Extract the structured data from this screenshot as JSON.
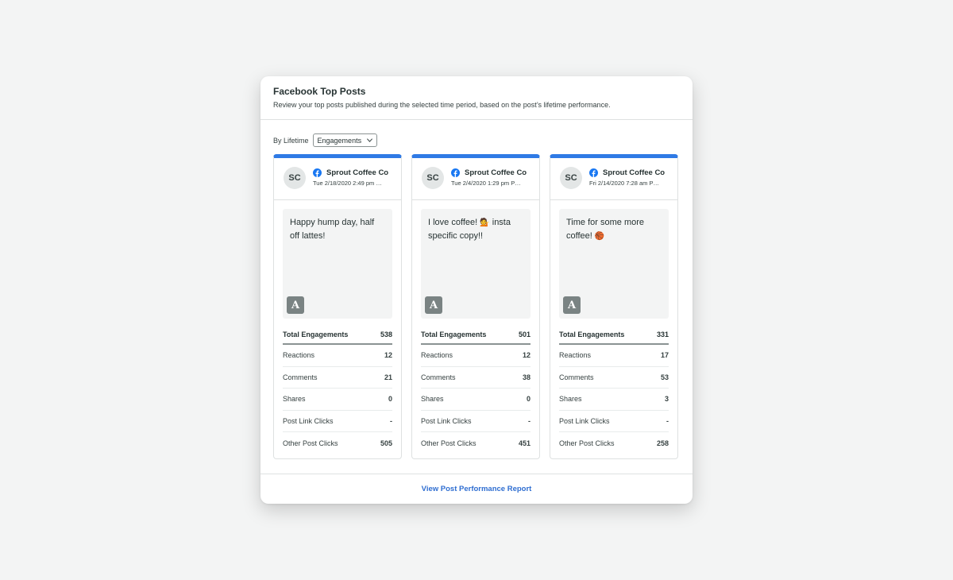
{
  "widget": {
    "title": "Facebook Top Posts",
    "subtitle": "Review your top posts published during the selected time period, based on the post’s lifetime performance."
  },
  "filter": {
    "label": "By Lifetime",
    "selected": "Engagements"
  },
  "colors": {
    "accent": "#2f7ae5",
    "facebook": "#1877f2",
    "link": "#2f6ed1"
  },
  "metric_labels": {
    "total": "Total Engagements",
    "reactions": "Reactions",
    "comments": "Comments",
    "shares": "Shares",
    "post_link_clicks": "Post Link Clicks",
    "other_post_clicks": "Other Post Clicks"
  },
  "posts": [
    {
      "avatar": "SC",
      "account": "Sprout Coffee Co",
      "timestamp": "Tue 2/18/2020 2:49 pm …",
      "text": "Happy hump day, half off lattes!",
      "emoji": "",
      "badge": "A",
      "metrics": {
        "total": "538",
        "reactions": "12",
        "comments": "21",
        "shares": "0",
        "post_link_clicks": "-",
        "other_post_clicks": "505"
      }
    },
    {
      "avatar": "SC",
      "account": "Sprout Coffee Co",
      "timestamp": "Tue 2/4/2020 1:29 pm P…",
      "text": "I love coffee!",
      "emoji": "💁",
      "text_after": " insta specific copy!!",
      "badge": "A",
      "metrics": {
        "total": "501",
        "reactions": "12",
        "comments": "38",
        "shares": "0",
        "post_link_clicks": "-",
        "other_post_clicks": "451"
      }
    },
    {
      "avatar": "SC",
      "account": "Sprout Coffee Co",
      "timestamp": "Fri 2/14/2020 7:28 am P…",
      "text": "Time for some more coffee!",
      "emoji": "🏀",
      "badge": "A",
      "metrics": {
        "total": "331",
        "reactions": "17",
        "comments": "53",
        "shares": "3",
        "post_link_clicks": "-",
        "other_post_clicks": "258"
      }
    }
  ],
  "footer": {
    "link": "View Post Performance Report"
  }
}
